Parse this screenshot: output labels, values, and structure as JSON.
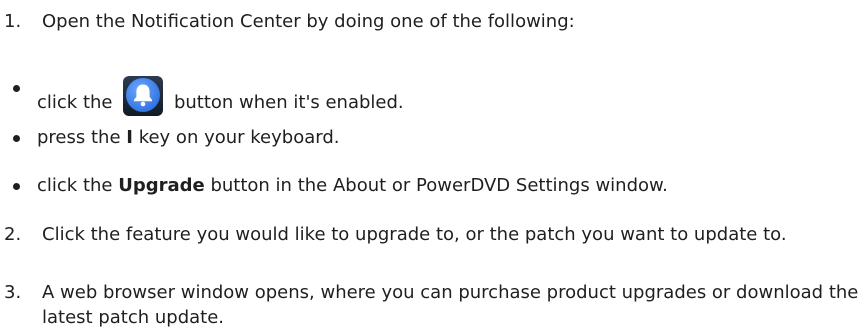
{
  "steps": [
    {
      "number": "1.",
      "text": "Open the Notification Center by doing one of the following:"
    },
    {
      "number": "2.",
      "text": "Click the feature you would like to upgrade to, or the patch you want to update to."
    },
    {
      "number": "3.",
      "text": "A web browser window opens, where you can purchase product upgrades or download the latest patch update."
    }
  ],
  "bullets": [
    {
      "before": "click the",
      "icon": "notification-bell-icon",
      "after": "button when it's enabled."
    },
    {
      "before": "press the",
      "key": "I",
      "after": "key on your keyboard."
    },
    {
      "before": "click the",
      "bold": "Upgrade",
      "after": "button in the About or PowerDVD Settings window."
    }
  ],
  "colors": {
    "text": "#1f1f1f",
    "bell_button_blue": "#3f7fe6",
    "bell_button_dark": "#1e2a3a"
  }
}
